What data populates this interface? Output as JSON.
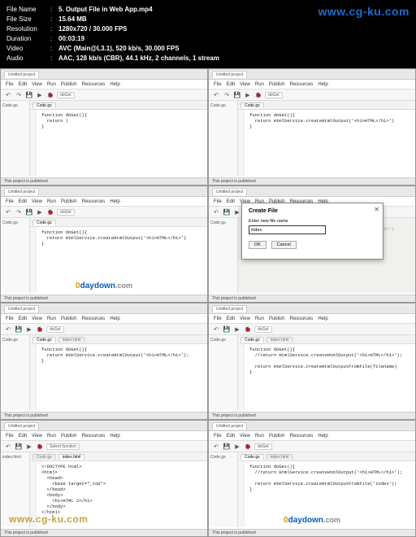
{
  "meta": {
    "file_name_label": "File Name",
    "file_name": "5. Output File in Web App.mp4",
    "file_size_label": "File Size",
    "file_size": "15.64 MB",
    "resolution_label": "Resolution",
    "resolution": "1280x720 / 30.000 FPS",
    "duration_label": "Duration",
    "duration": "00:03:19",
    "video_label": "Video",
    "video": "AVC (Main@L3.1), 520 kb/s, 30.000 FPS",
    "audio_label": "Audio",
    "audio": "AAC, 128 kb/s (CBR), 44.1 kHz, 2 channels, 1 stream"
  },
  "wm_top": "www.cg-ku.com",
  "wm_0day_o": "0",
  "wm_0day_text": "daydown",
  "wm_0day_dom": ".com",
  "wm_cgku": "www.cg-ku.com",
  "menu": [
    "File",
    "Edit",
    "View",
    "Run",
    "Publish",
    "Resources",
    "Help"
  ],
  "toolbar": {
    "select_fn": "doGet",
    "select_fn2": "Select function"
  },
  "sidebar": {
    "label": "Code.gs"
  },
  "tabs": {
    "left": "⬤",
    "mid": "Untitled project"
  },
  "file_tabs": {
    "code": "Code.gs",
    "index": "index.html"
  },
  "footer": "This project is published",
  "code1": "function doGet(){\n  return |\n}",
  "code2": "function doGet(){\n  return HtmlService.createHtmlOutput('<h1>HTML</h1>')\n}",
  "code3": "function doGet(){\n  return HtmlService.createHtmlOutput('<h1>HTML</h1>')\n}",
  "code4_dim": "function doGet(){\n  return HtmlService.createHtmlOutput('<h1>HTML</h1>')\n}",
  "code5": "function doGet(){\n  return HtmlService.createHtmlOutput('<h1>HTML</h1>');\n}",
  "code6": "function doGet(){\n  //return HtmlService.createHtmlOutput('<h1>HTML</h1>');\n\n  return HtmlService.createHtmlOutputFromFile(filename)\n}",
  "code7": "<!DOCTYPE html>\n<html>\n  <head>\n    <base target=\"_top\">\n  </head>\n  <body>\n    <h1>HTML 2</h1>\n  </body>\n</html>",
  "code8": "function doGet(){\n  //return HtmlService.createHtmlOutput('<h1>HTML</h1>');\n\n  return HtmlService.createHtmlOutputFromFile('index')|\n}",
  "dialog": {
    "title": "Create File",
    "label": "Enter new file name",
    "value": "index",
    "ok": "OK",
    "cancel": "Cancel"
  }
}
